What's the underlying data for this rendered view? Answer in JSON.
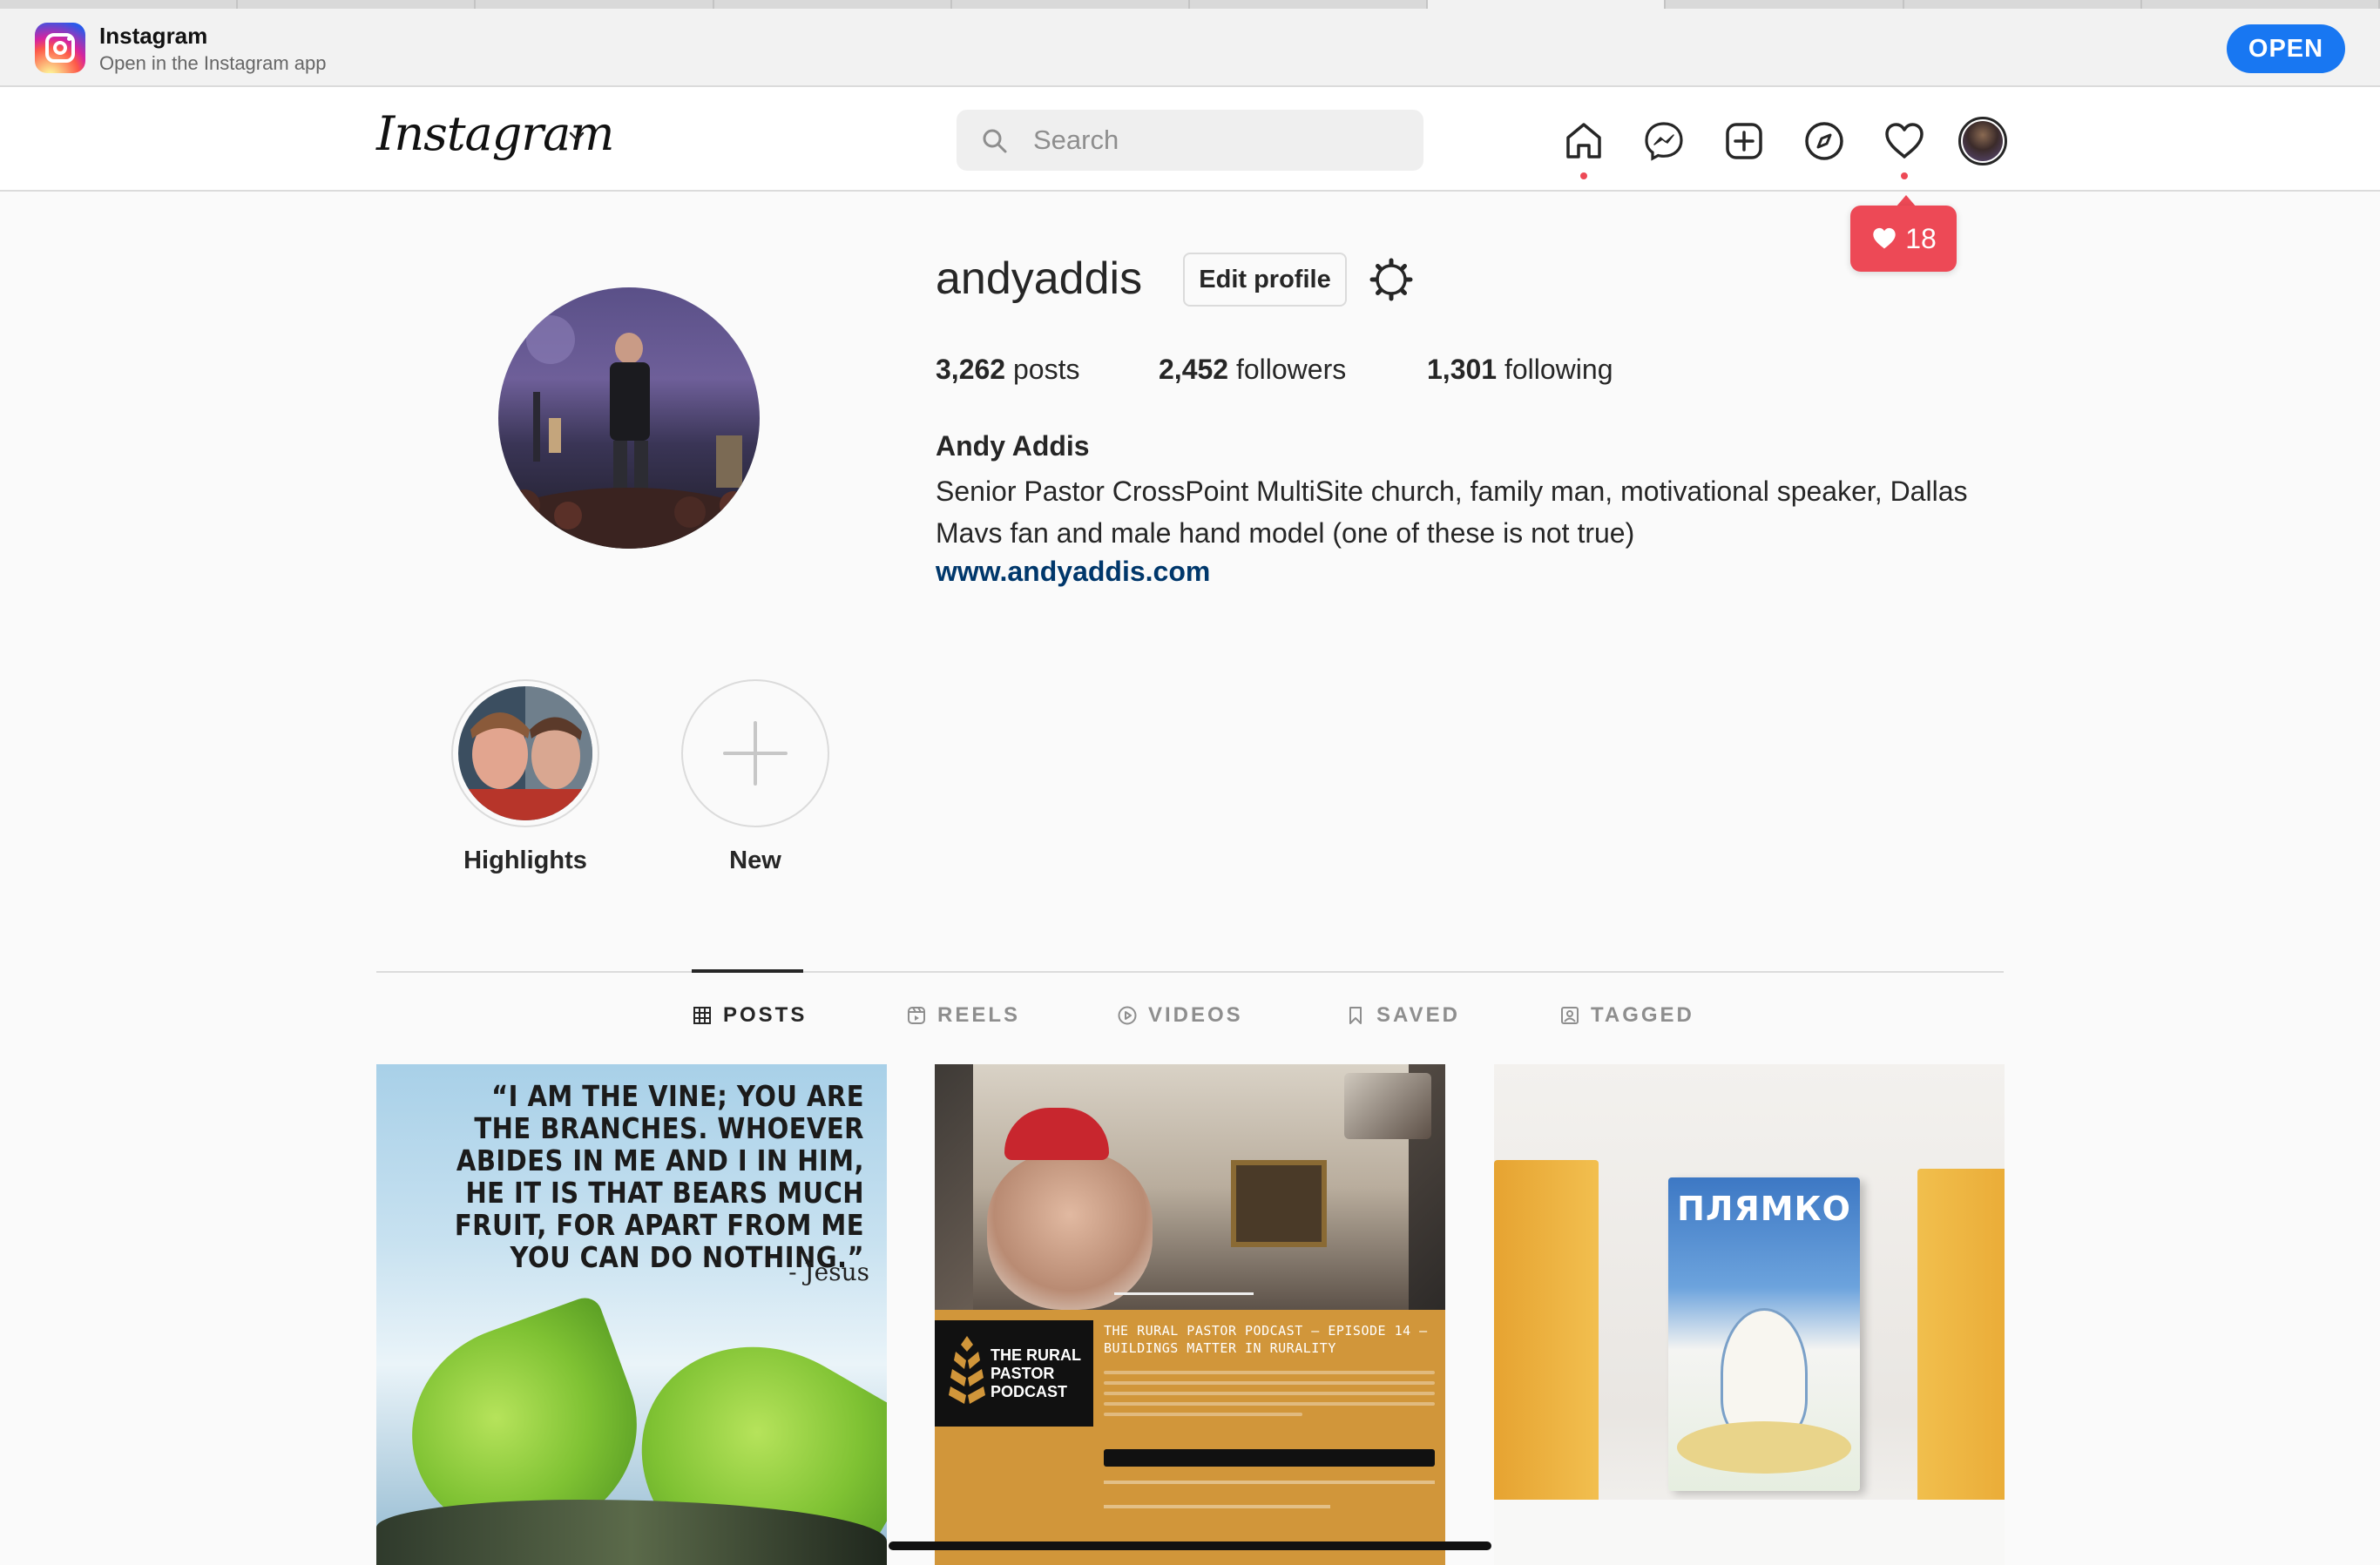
{
  "banner": {
    "app_name": "Instagram",
    "subtitle": "Open in the Instagram app",
    "open_label": "OPEN"
  },
  "nav": {
    "logo": "Instagram",
    "search_placeholder": "Search"
  },
  "notification": {
    "count": "18"
  },
  "profile": {
    "username": "andyaddis",
    "edit_label": "Edit profile",
    "posts_count": "3,262",
    "posts_label": "posts",
    "followers_count": "2,452",
    "followers_label": "followers",
    "following_count": "1,301",
    "following_label": "following",
    "full_name": "Andy Addis",
    "bio": "Senior Pastor CrossPoint MultiSite church, family man, motivational speaker, Dallas Mavs fan and male hand model (one of these is not true)",
    "website": "www.andyaddis.com"
  },
  "highlights": [
    {
      "label": "Highlights"
    },
    {
      "label": "New"
    }
  ],
  "tabs": [
    {
      "label": "POSTS"
    },
    {
      "label": "REELS"
    },
    {
      "label": "VIDEOS"
    },
    {
      "label": "SAVED"
    },
    {
      "label": "TAGGED"
    }
  ],
  "posts": {
    "p1_quote": "“I AM THE VINE; YOU ARE THE BRANCHES. WHOEVER ABIDES IN ME AND I IN HIM, HE IT IS THAT BEARS MUCH FRUIT, FOR APART FROM ME YOU CAN DO NOTHING.”",
    "p1_attr": "- Jesus",
    "p2_logo": "THE RURAL PASTOR PODCAST",
    "p2_title": "THE RURAL PASTOR PODCAST – EPISODE 14 – BUILDINGS MATTER IN RURALITY",
    "p3_book": "ПЛЯМКО"
  },
  "colors": {
    "accent": "#1877f2",
    "notification": "#ed4956",
    "link": "#00376b"
  }
}
